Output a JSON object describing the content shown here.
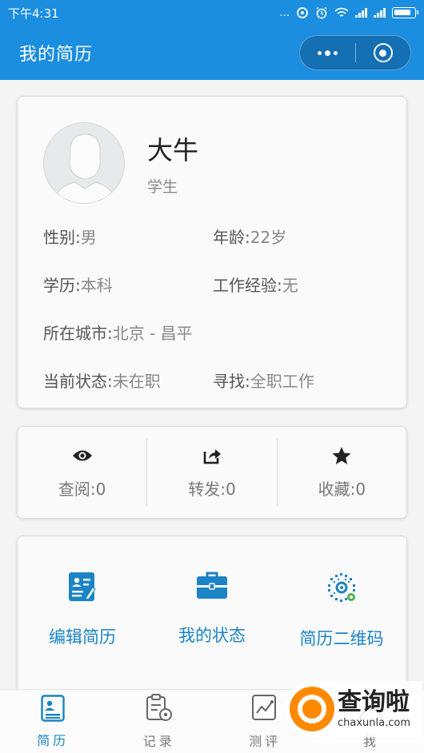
{
  "status_bar": {
    "time": "下午4:31",
    "dots": "...",
    "signal_1": "4G",
    "signal_2": "4G"
  },
  "nav": {
    "title": "我的简历"
  },
  "profile": {
    "name": "大牛",
    "role": "学生",
    "fields": [
      {
        "key": "性别:",
        "value": "男"
      },
      {
        "key": "年龄:",
        "value": "22岁"
      },
      {
        "key": "学历:",
        "value": "本科"
      },
      {
        "key": "工作经验:",
        "value": "无"
      },
      {
        "key": "所在城市:",
        "value": "北京 - 昌平"
      },
      {
        "key": "当前状态:",
        "value": "未在职"
      },
      {
        "key": "寻找:",
        "value": "全职工作"
      }
    ]
  },
  "stats": [
    {
      "icon": "eye-icon",
      "label": "查阅:",
      "value": "0"
    },
    {
      "icon": "share-icon",
      "label": "转发:",
      "value": "0"
    },
    {
      "icon": "star-icon",
      "label": "收藏:",
      "value": "0"
    }
  ],
  "actions": [
    {
      "icon": "edit-resume-icon",
      "label": "编辑简历"
    },
    {
      "icon": "briefcase-icon",
      "label": "我的状态"
    },
    {
      "icon": "qr-code-icon",
      "label": "简历二维码"
    }
  ],
  "tabs": [
    {
      "icon": "resume-icon",
      "label": "简历",
      "active": true
    },
    {
      "icon": "record-icon",
      "label": "记录",
      "active": false
    },
    {
      "icon": "evaluation-icon",
      "label": "测评",
      "active": false
    },
    {
      "icon": "me-icon",
      "label": "我",
      "active": false
    }
  ],
  "watermark": {
    "main": "查询啦",
    "sub": "chaxunla.com"
  },
  "colors": {
    "brand_blue": "#1b8ee0",
    "action_blue": "#1b84c4",
    "watermark_orange": "#ff8a00"
  }
}
